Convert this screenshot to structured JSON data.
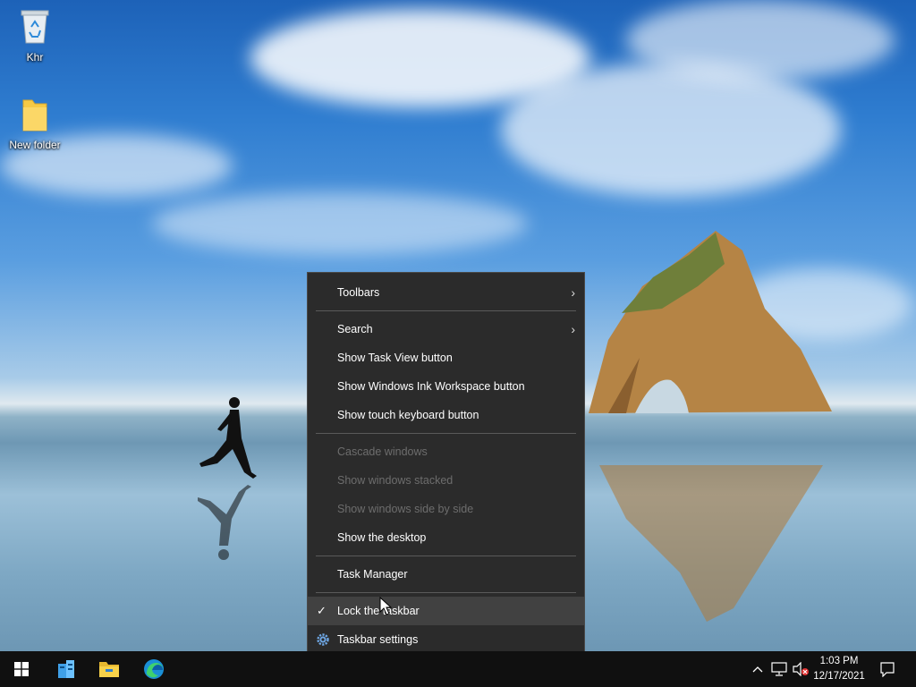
{
  "desktop": {
    "icons": [
      {
        "label": "Khr",
        "icon": "recycle-bin-icon"
      },
      {
        "label": "New folder",
        "icon": "folder-icon"
      }
    ]
  },
  "context_menu": {
    "items": [
      {
        "label": "Toolbars",
        "submenu": true
      },
      {
        "label": "Search",
        "submenu": true
      },
      {
        "label": "Show Task View button"
      },
      {
        "label": "Show Windows Ink Workspace button"
      },
      {
        "label": "Show touch keyboard button"
      },
      {
        "label": "Cascade windows",
        "disabled": true
      },
      {
        "label": "Show windows stacked",
        "disabled": true
      },
      {
        "label": "Show windows side by side",
        "disabled": true
      },
      {
        "label": "Show the desktop"
      },
      {
        "label": "Task Manager"
      },
      {
        "label": "Lock the taskbar",
        "checked": true,
        "hover": true
      },
      {
        "label": "Taskbar settings",
        "icon": "gear-icon"
      }
    ],
    "arrow_glyph": "›",
    "check_glyph": "✓"
  },
  "taskbar": {
    "apps": [
      "start-icon",
      "server-manager-icon",
      "file-explorer-icon",
      "edge-icon"
    ],
    "clock": {
      "time": "1:03 PM",
      "date": "12/17/2021"
    },
    "tray_icons": [
      "chevron-up-icon",
      "network-icon",
      "volume-muted-icon",
      "notifications-icon"
    ]
  },
  "colors": {
    "menu_bg": "#2b2b2b",
    "menu_hover": "#414141",
    "taskbar_bg": "#101010",
    "disabled_text": "#6d6d6d"
  }
}
